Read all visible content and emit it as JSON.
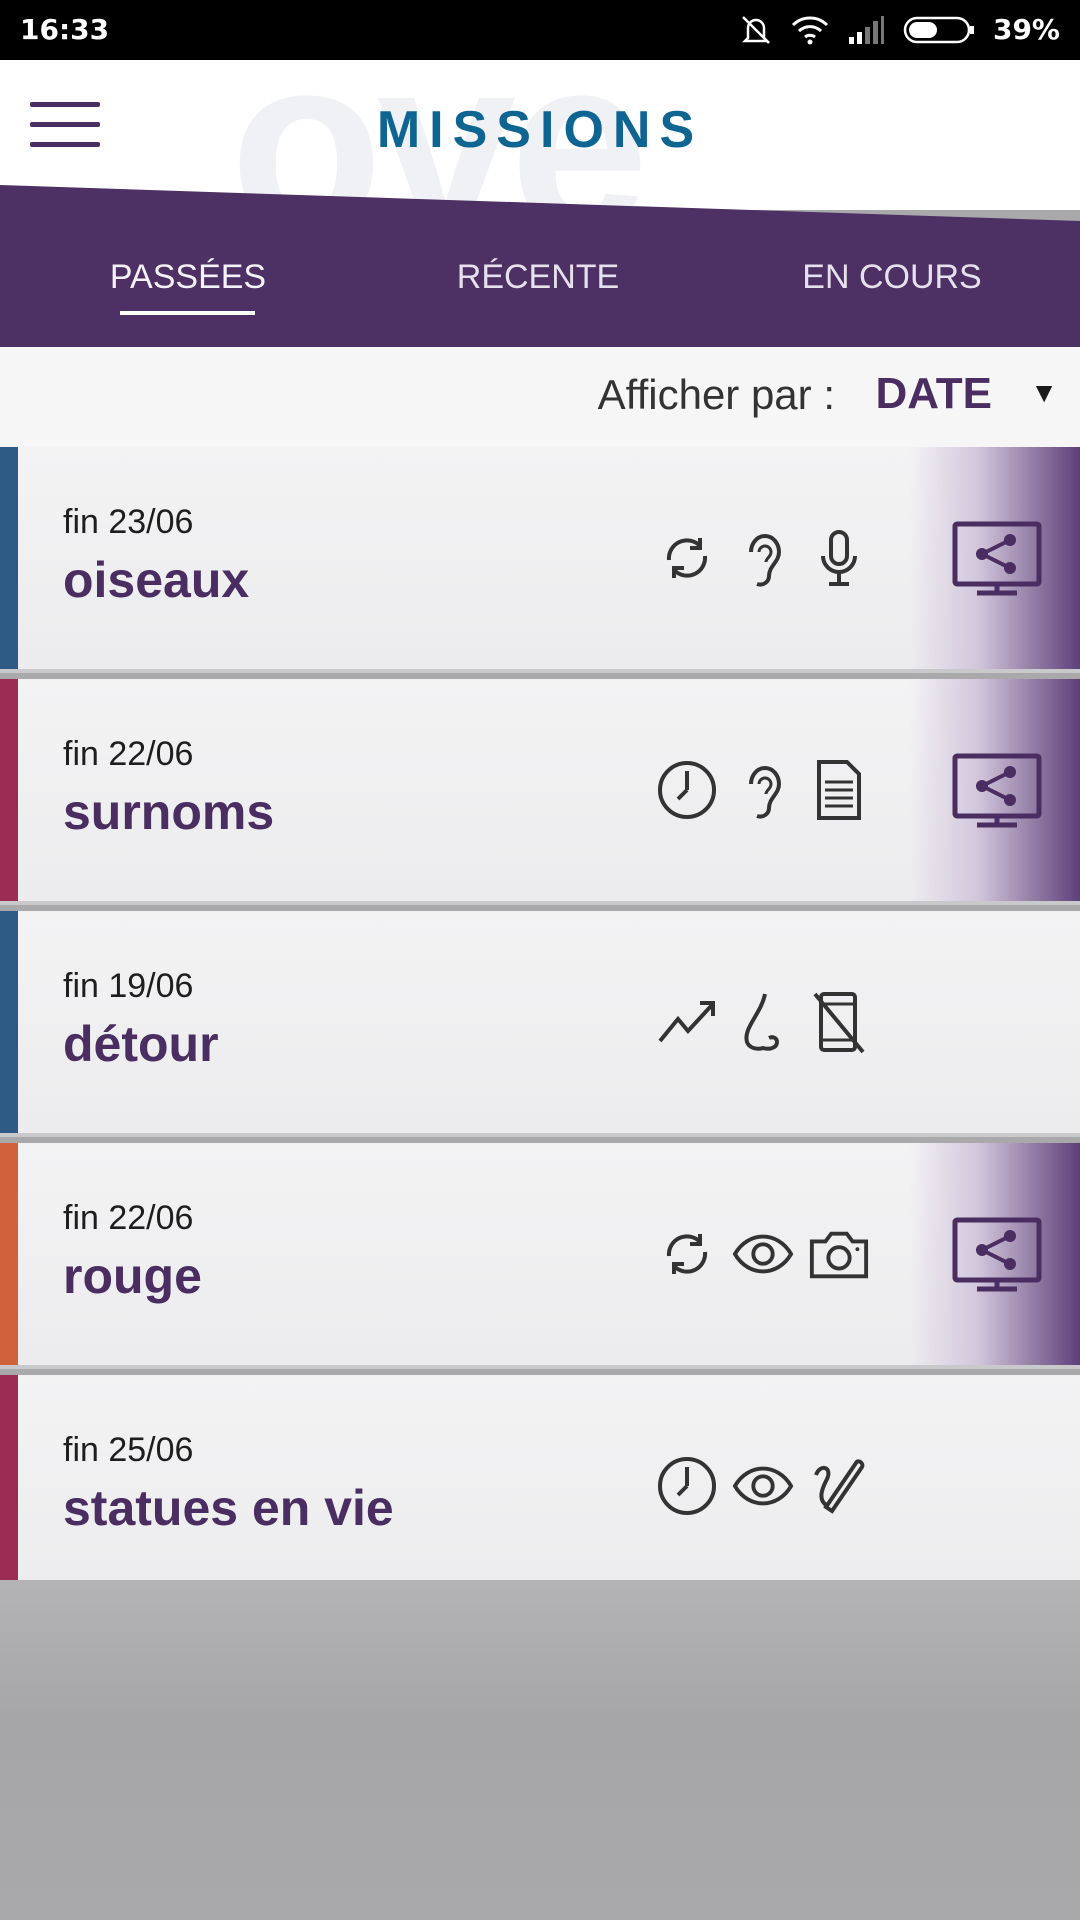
{
  "status_bar": {
    "time": "16:33",
    "battery": "39%"
  },
  "header": {
    "title": "MISSIONS",
    "watermark": "ove"
  },
  "tabs": [
    {
      "label": "PASSÉES",
      "active": true
    },
    {
      "label": "RÉCENTE",
      "active": false
    },
    {
      "label": "EN COURS",
      "active": false
    }
  ],
  "sort": {
    "label": "Afficher par :",
    "value": "DATE"
  },
  "missions": [
    {
      "date": "fin 23/06",
      "title": "oiseaux",
      "color": "#2e5a86",
      "icons": [
        "refresh-icon",
        "ear-icon",
        "microphone-icon"
      ],
      "shareable": true
    },
    {
      "date": "fin 22/06",
      "title": "surnoms",
      "color": "#9b2d55",
      "icons": [
        "clock-icon",
        "ear-icon",
        "document-icon"
      ],
      "shareable": true
    },
    {
      "date": "fin 19/06",
      "title": "détour",
      "color": "#2e5a86",
      "icons": [
        "trend-icon",
        "nose-icon",
        "no-phone-icon"
      ],
      "shareable": false
    },
    {
      "date": "fin 22/06",
      "title": "rouge",
      "color": "#d0613a",
      "icons": [
        "refresh-icon",
        "eye-icon",
        "camera-icon"
      ],
      "shareable": true
    },
    {
      "date": "fin 25/06",
      "title": "statues en vie",
      "color": "#9b2d55",
      "icons": [
        "clock-icon",
        "eye-icon",
        "pencil-icon"
      ],
      "shareable": false
    }
  ]
}
